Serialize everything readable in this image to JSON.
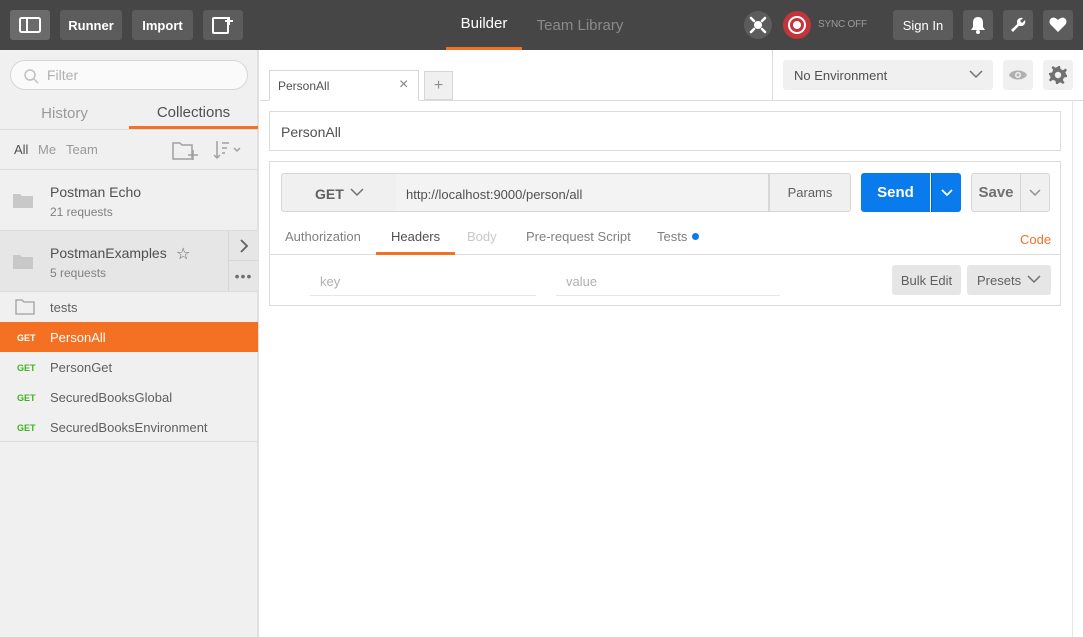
{
  "topbar": {
    "runner_label": "Runner",
    "import_label": "Import",
    "tabs": {
      "builder": "Builder",
      "team_library": "Team Library"
    },
    "sync_label": "SYNC OFF",
    "signin_label": "Sign In",
    "accent_color": "#f47023"
  },
  "sidebar": {
    "filter_placeholder": "Filter",
    "tabs": {
      "history": "History",
      "collections": "Collections"
    },
    "filters": {
      "all": "All",
      "me": "Me",
      "team": "Team"
    },
    "collections": [
      {
        "name": "Postman Echo",
        "count": "21 requests"
      },
      {
        "name": "PostmanExamples",
        "count": "5 requests"
      }
    ],
    "folder": {
      "name": "tests"
    },
    "requests": [
      {
        "method": "GET",
        "name": "PersonAll"
      },
      {
        "method": "GET",
        "name": "PersonGet"
      },
      {
        "method": "GET",
        "name": "SecuredBooksGlobal"
      },
      {
        "method": "GET",
        "name": "SecuredBooksEnvironment"
      }
    ]
  },
  "main": {
    "open_tab_label": "PersonAll",
    "environment": "No Environment",
    "request_name": "PersonAll",
    "method": "GET",
    "url": "http://localhost:9000/person/all",
    "params_label": "Params",
    "send_label": "Send",
    "save_label": "Save",
    "request_tabs": {
      "authorization": "Authorization",
      "headers": "Headers",
      "body": "Body",
      "pre_request": "Pre-request Script",
      "tests": "Tests",
      "code": "Code"
    },
    "headers_editor": {
      "key_placeholder": "key",
      "value_placeholder": "value",
      "bulk_edit_label": "Bulk Edit",
      "presets_label": "Presets"
    },
    "send_color": "#097bed"
  }
}
